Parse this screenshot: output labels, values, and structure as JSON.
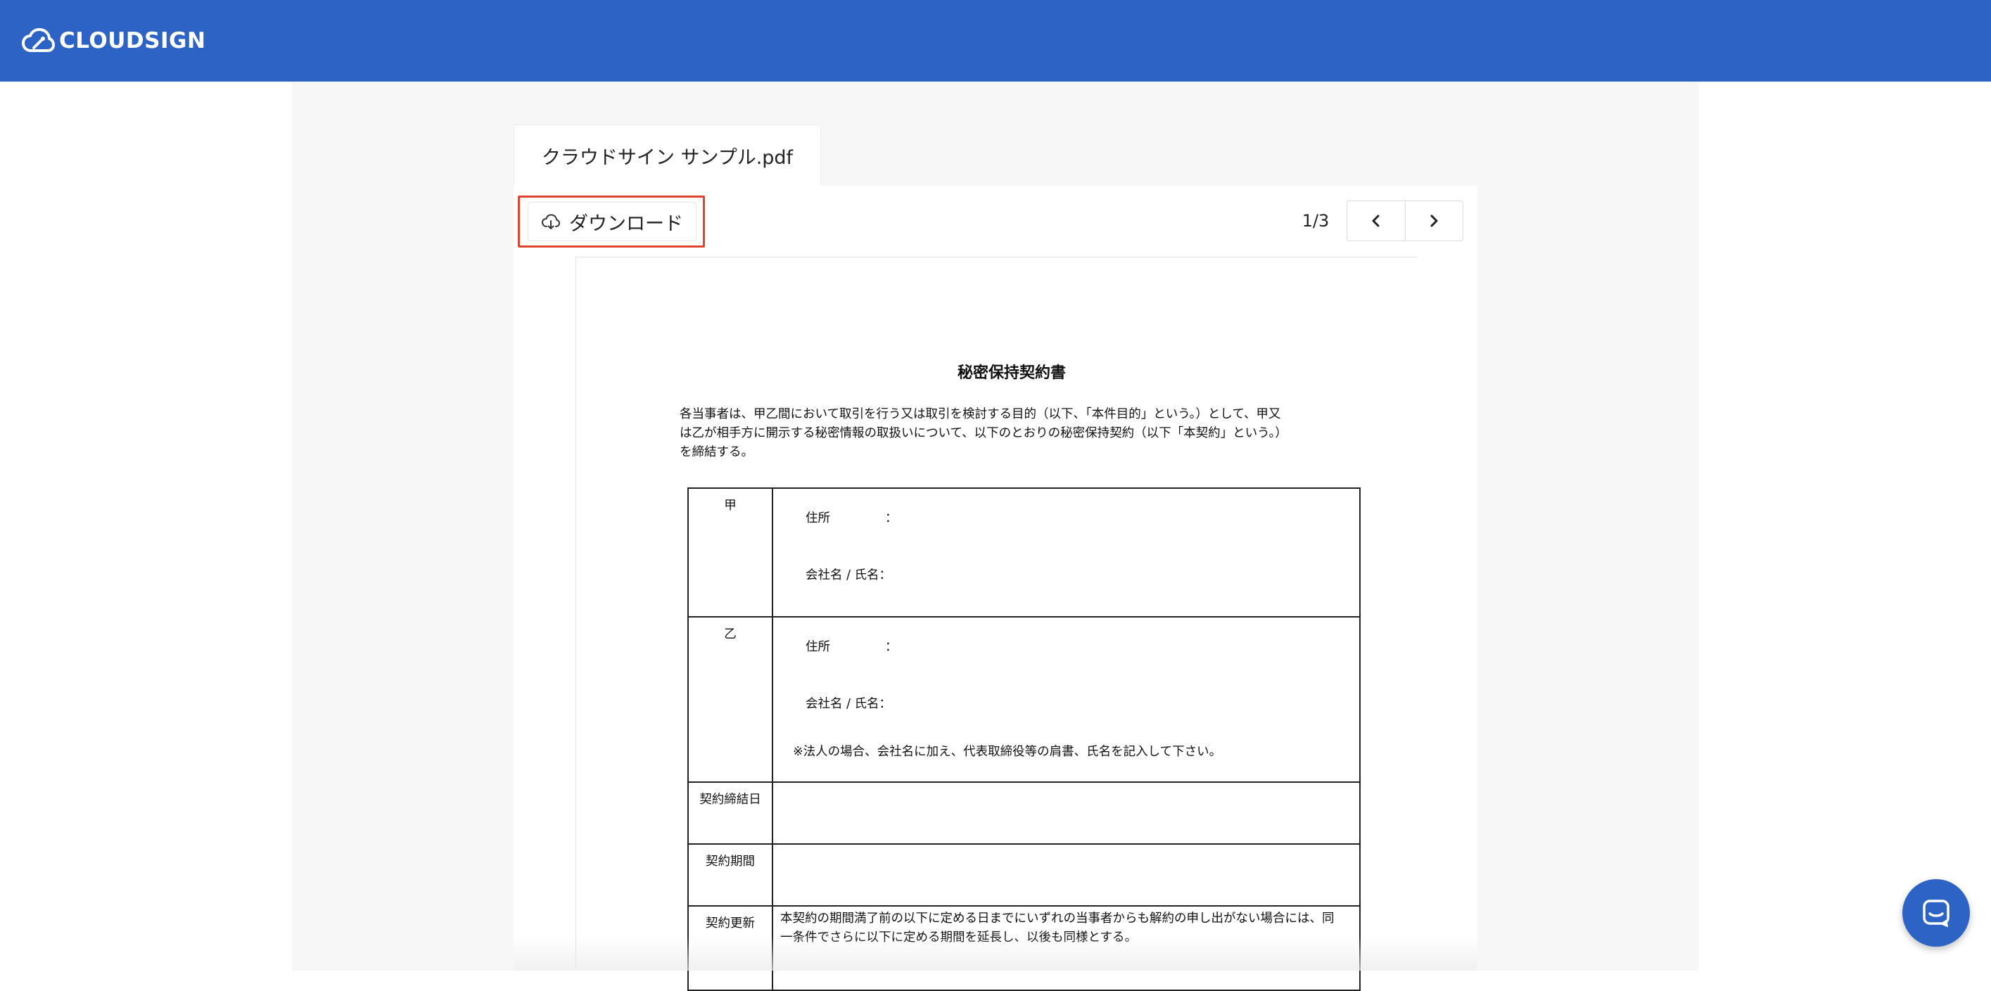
{
  "header": {
    "brand": "CLOUDSIGN"
  },
  "file_tab": {
    "label": "クラウドサイン サンプル.pdf"
  },
  "toolbar": {
    "download_label": "ダウンロード",
    "page_indicator": "1/3"
  },
  "document": {
    "title": "秘密保持契約書",
    "intro_lines": [
      "各当事者は、甲乙間において取引を行う又は取引を検討する目的（以下、「本件目的」という。）として、甲又",
      "は乙が相手方に開示する秘密情報の取扱いについて、以下のとおりの秘密保持契約（以下「本契約」という。）",
      "を締結する。"
    ],
    "table": {
      "party_a": {
        "label": "甲",
        "address_key": "住所",
        "address_colon": "：",
        "name_key": "会社名 / 氏名："
      },
      "party_b": {
        "label": "乙",
        "address_key": "住所",
        "address_colon": "：",
        "name_key": "会社名 / 氏名：",
        "note": "※法人の場合、会社名に加え、代表取締役等の肩書、氏名を記入して下さい。"
      },
      "date_label": "契約締結日",
      "period_label": "契約期間",
      "renewal_label": "契約更新",
      "renewal_lines": [
        "本契約の期間満了前の以下に定める日までにいずれの当事者からも解約の申し出がない場合には、同",
        "一条件でさらに以下に定める期間を延長し、以後も同様とする。"
      ]
    }
  },
  "colors": {
    "header_bg": "#2d63c5",
    "highlight": "#e0442e",
    "content_bg": "#f7f7f7"
  },
  "icons": {
    "logo": "cloud-pen-icon",
    "download": "cloud-download-icon",
    "prev": "chevron-left-icon",
    "next": "chevron-right-icon",
    "chat": "chat-bubble-icon"
  }
}
